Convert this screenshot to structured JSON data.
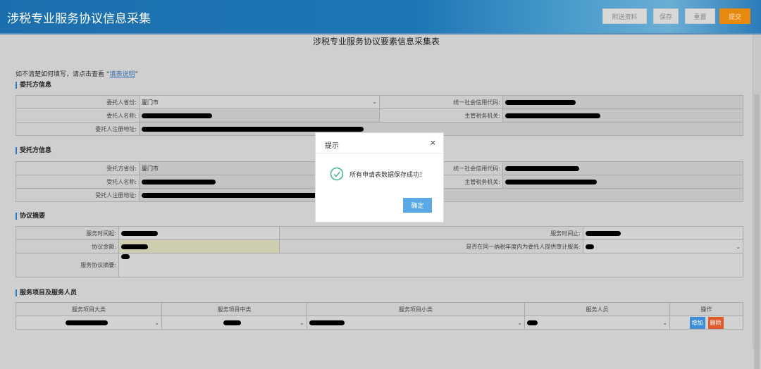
{
  "header": {
    "title": "涉税专业服务协议信息采集",
    "buttons": {
      "attach": "附送资料",
      "save": "保存",
      "reset": "重置",
      "submit": "提交"
    }
  },
  "form": {
    "title": "涉税专业服务协议要素信息采集表",
    "hint_prefix": "如不清楚如何填写，请点击查看 “",
    "hint_link": "填表说明",
    "hint_suffix": "”",
    "client": {
      "heading": "委托方信息",
      "province_label": "委托人省份:",
      "province_value": "厦门市",
      "credit_label": "统一社会信用代码:",
      "name_label": "委托人名称:",
      "tax_office_label": "主管税务机关:",
      "address_label": "委托人注册地址:"
    },
    "agent": {
      "heading": "受托方信息",
      "province_label": "受托方省份:",
      "province_value": "厦门市",
      "credit_label": "统一社会信用代码:",
      "name_label": "受托人名称:",
      "tax_office_label": "主管税务机关:",
      "address_label": "受托人注册地址:"
    },
    "summary": {
      "heading": "协议摘要",
      "start_label": "服务时间起:",
      "end_label": "服务时间止:",
      "amount_label": "协议金额:",
      "audit_label": "是否在同一纳税年度内为委托人提供审计服务:",
      "summary_label": "服务协议摘要:"
    },
    "services": {
      "heading": "服务项目及服务人员",
      "columns": [
        "服务项目大类",
        "服务项目中类",
        "服务项目小类",
        "服务人员",
        "操作"
      ],
      "add": "增加",
      "delete": "删除"
    }
  },
  "dialog": {
    "title": "提示",
    "close": "×",
    "message": "所有申请表数据保存成功！",
    "ok": "确定"
  },
  "colors": {
    "submit": "#e8890f",
    "add": "#3d8ed8",
    "delete": "#e05a2b",
    "success": "#3bb08f"
  }
}
